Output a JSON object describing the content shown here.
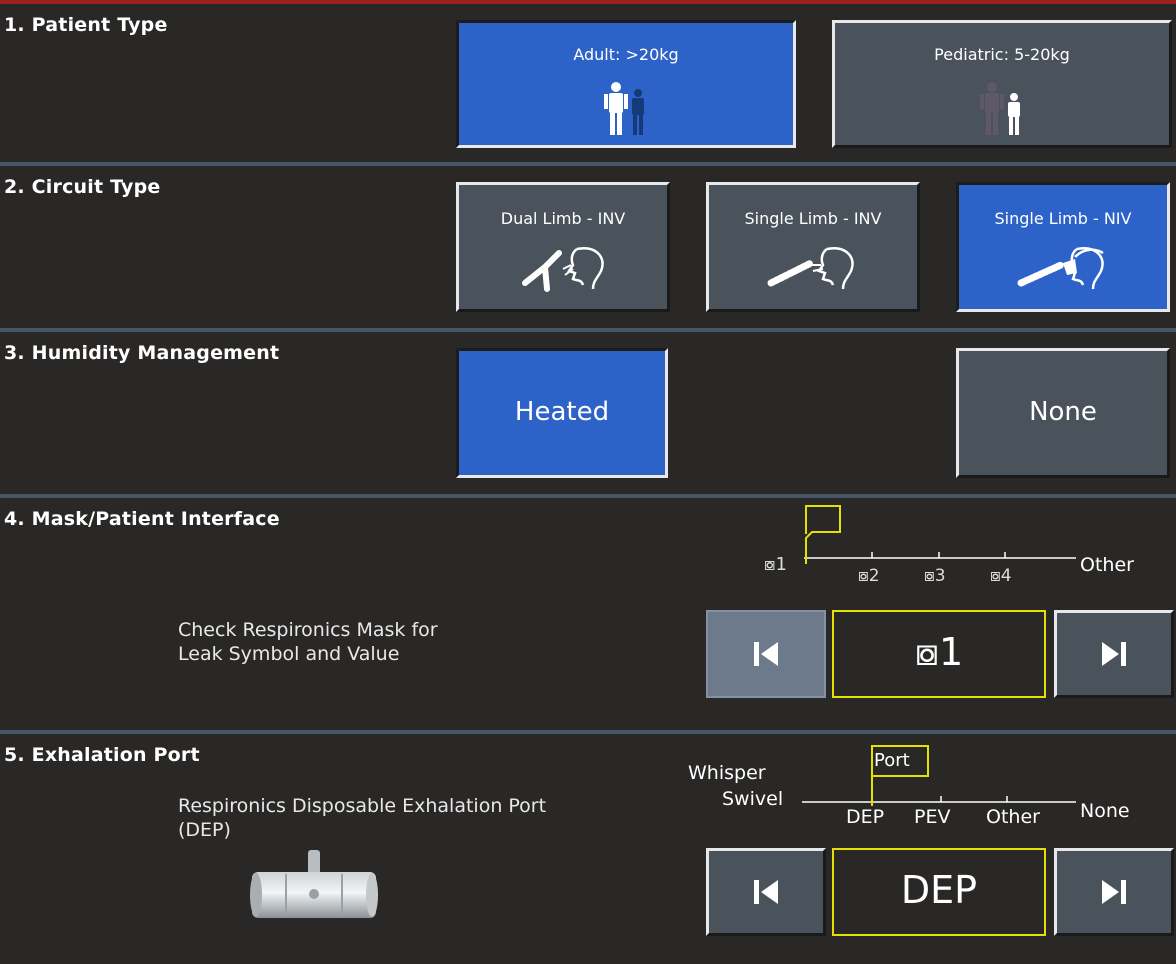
{
  "sections": {
    "patient_type": {
      "title": "1. Patient Type",
      "options": [
        {
          "label": "Adult: >20kg",
          "selected": true,
          "icon": "adult-figures-icon"
        },
        {
          "label": "Pediatric: 5-20kg",
          "selected": false,
          "icon": "pediatric-figures-icon"
        }
      ]
    },
    "circuit_type": {
      "title": "2. Circuit Type",
      "options": [
        {
          "label": "Dual Limb - INV",
          "selected": false,
          "icon": "dual-limb-circuit-icon"
        },
        {
          "label": "Single Limb - INV",
          "selected": false,
          "icon": "single-limb-inv-icon"
        },
        {
          "label": "Single Limb - NIV",
          "selected": true,
          "icon": "single-limb-niv-icon"
        }
      ]
    },
    "humidity": {
      "title": "3. Humidity Management",
      "options": [
        {
          "label": "Heated",
          "selected": true
        },
        {
          "label": "None",
          "selected": false
        }
      ]
    },
    "mask": {
      "title": "4. Mask/Patient Interface",
      "info_line1": "Check Respironics Mask for",
      "info_line2": "Leak Symbol and Value",
      "scale_labels": [
        "⧇1",
        "⧇2",
        "⧇3",
        "⧇4",
        "Other"
      ],
      "current_value": "⧇1",
      "prev_enabled": false,
      "next_enabled": true
    },
    "exhalation": {
      "title": "5. Exhalation Port",
      "info_line1": "Respironics Disposable Exhalation Port",
      "info_line2": "(DEP)",
      "scale_left_top": "Whisper",
      "scale_left_bottom": "Swivel",
      "scale_labels": [
        "DEP",
        "PEV",
        "Other"
      ],
      "scale_right": "None",
      "marker_label": "Port",
      "current_value": "DEP",
      "image": "exhalation-port-photo",
      "prev_enabled": true,
      "next_enabled": true
    }
  },
  "colors": {
    "background": "#2a2826",
    "selected": "#2d62c9",
    "unselected": "#4a525b",
    "divider": "#475666",
    "highlight": "#e6e000"
  }
}
